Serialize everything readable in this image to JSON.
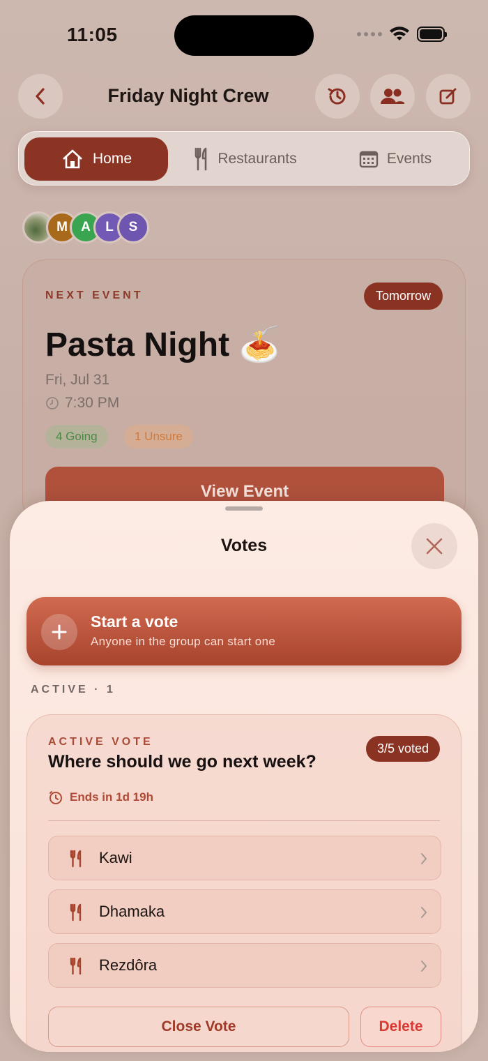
{
  "status_bar": {
    "time": "11:05"
  },
  "header": {
    "title": "Friday Night Crew"
  },
  "tabs": [
    {
      "label": "Home",
      "icon": "home-icon",
      "active": true
    },
    {
      "label": "Restaurants",
      "icon": "fork-knife-icon",
      "active": false
    },
    {
      "label": "Events",
      "icon": "calendar-icon",
      "active": false
    }
  ],
  "members": [
    {
      "initial": "",
      "color": "#6b7a5a"
    },
    {
      "initial": "M",
      "color": "#a86a1a"
    },
    {
      "initial": "A",
      "color": "#3aa551"
    },
    {
      "initial": "L",
      "color": "#7159b5"
    },
    {
      "initial": "S",
      "color": "#6e55b0"
    }
  ],
  "event": {
    "label": "NEXT EVENT",
    "badge": "Tomorrow",
    "title": "Pasta Night 🍝",
    "date": "Fri, Jul 31",
    "time": "7:30 PM",
    "going": "4 Going",
    "unsure": "1 Unsure",
    "button": "View Event"
  },
  "sheet": {
    "title": "Votes",
    "start_vote": {
      "title": "Start a vote",
      "subtitle": "Anyone in the group can start one"
    },
    "section_label": "ACTIVE · 1",
    "active_vote": {
      "label": "ACTIVE VOTE",
      "voted": "3/5 voted",
      "question": "Where should we go next week?",
      "ends": "Ends in 1d 19h",
      "options": [
        "Kawi",
        "Dhamaka",
        "Rezdôra"
      ],
      "close_label": "Close Vote",
      "delete_label": "Delete"
    }
  },
  "colors": {
    "accent": "#8b3323",
    "going": "#4a8a45",
    "unsure": "#d07a3b",
    "delete": "#d63a33"
  }
}
